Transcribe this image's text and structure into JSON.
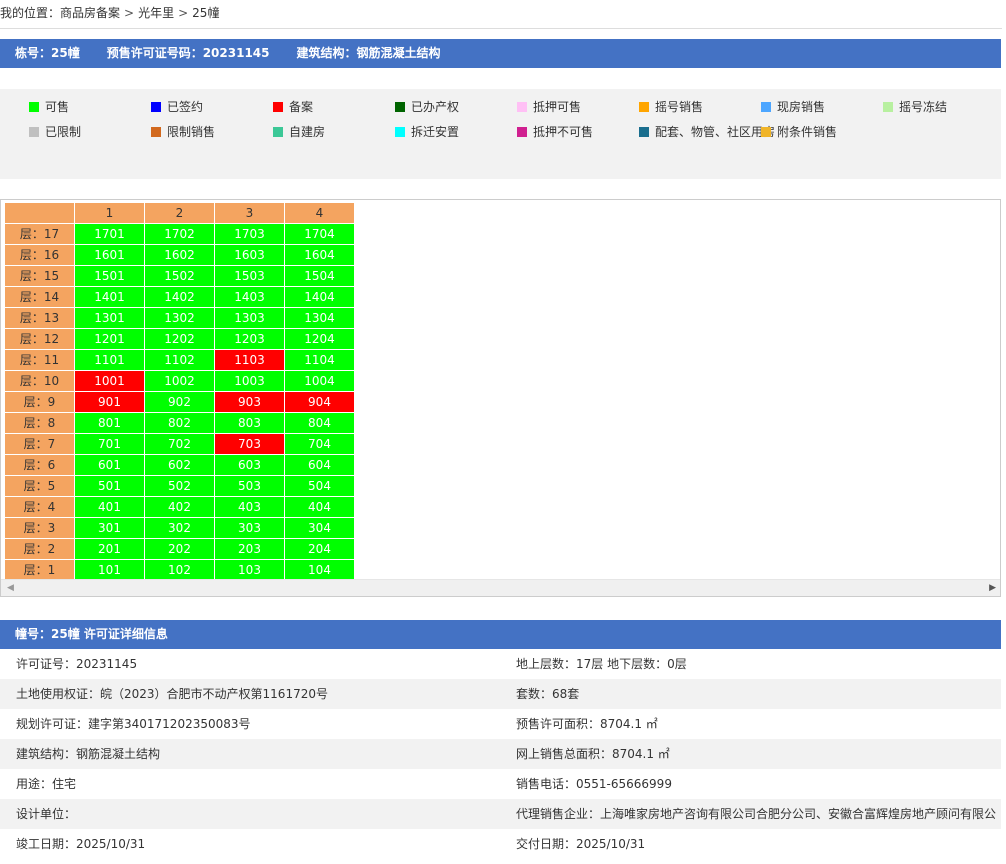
{
  "breadcrumb": {
    "prefix": "我的位置：",
    "items": [
      "商品房备案",
      "光年里",
      "25幢"
    ],
    "separator": ">"
  },
  "building_bar": {
    "building_no": "栋号：25幢",
    "presale_permit": "预售许可证号码：20231145",
    "structure": "建筑结构：钢筋混凝土结构"
  },
  "legend": [
    {
      "label": "可售",
      "color": "#00ff00"
    },
    {
      "label": "已签约",
      "color": "#0000ff"
    },
    {
      "label": "备案",
      "color": "#ff0000"
    },
    {
      "label": "已办产权",
      "color": "#006400"
    },
    {
      "label": "抵押可售",
      "color": "#ffc0f5"
    },
    {
      "label": "摇号销售",
      "color": "#ffa500"
    },
    {
      "label": "现房销售",
      "color": "#4da6ff"
    },
    {
      "label": "摇号冻结",
      "color": "#b8f0a0"
    },
    {
      "label": "已限制",
      "color": "#c0c0c0"
    },
    {
      "label": "限制销售",
      "color": "#d2691e"
    },
    {
      "label": "自建房",
      "color": "#3cc897"
    },
    {
      "label": "拆迁安置",
      "color": "#00ffff"
    },
    {
      "label": "抵押不可售",
      "color": "#d02090"
    },
    {
      "label": "配套、物管、社区用房",
      "color": "#1a6e8e"
    },
    {
      "label": "附条件销售",
      "color": "#f0b428"
    }
  ],
  "grid": {
    "columns": [
      "1",
      "2",
      "3",
      "4"
    ],
    "floor_prefix": "层：",
    "floors": [
      {
        "floor": "17",
        "units": [
          {
            "no": "1701",
            "status": "可售"
          },
          {
            "no": "1702",
            "status": "可售"
          },
          {
            "no": "1703",
            "status": "可售"
          },
          {
            "no": "1704",
            "status": "可售"
          }
        ]
      },
      {
        "floor": "16",
        "units": [
          {
            "no": "1601",
            "status": "可售"
          },
          {
            "no": "1602",
            "status": "可售"
          },
          {
            "no": "1603",
            "status": "可售"
          },
          {
            "no": "1604",
            "status": "可售"
          }
        ]
      },
      {
        "floor": "15",
        "units": [
          {
            "no": "1501",
            "status": "可售"
          },
          {
            "no": "1502",
            "status": "可售"
          },
          {
            "no": "1503",
            "status": "可售"
          },
          {
            "no": "1504",
            "status": "可售"
          }
        ]
      },
      {
        "floor": "14",
        "units": [
          {
            "no": "1401",
            "status": "可售"
          },
          {
            "no": "1402",
            "status": "可售"
          },
          {
            "no": "1403",
            "status": "可售"
          },
          {
            "no": "1404",
            "status": "可售"
          }
        ]
      },
      {
        "floor": "13",
        "units": [
          {
            "no": "1301",
            "status": "可售"
          },
          {
            "no": "1302",
            "status": "可售"
          },
          {
            "no": "1303",
            "status": "可售"
          },
          {
            "no": "1304",
            "status": "可售"
          }
        ]
      },
      {
        "floor": "12",
        "units": [
          {
            "no": "1201",
            "status": "可售"
          },
          {
            "no": "1202",
            "status": "可售"
          },
          {
            "no": "1203",
            "status": "可售"
          },
          {
            "no": "1204",
            "status": "可售"
          }
        ]
      },
      {
        "floor": "11",
        "units": [
          {
            "no": "1101",
            "status": "可售"
          },
          {
            "no": "1102",
            "status": "可售"
          },
          {
            "no": "1103",
            "status": "备案"
          },
          {
            "no": "1104",
            "status": "可售"
          }
        ]
      },
      {
        "floor": "10",
        "units": [
          {
            "no": "1001",
            "status": "备案"
          },
          {
            "no": "1002",
            "status": "可售"
          },
          {
            "no": "1003",
            "status": "可售"
          },
          {
            "no": "1004",
            "status": "可售"
          }
        ]
      },
      {
        "floor": "9",
        "units": [
          {
            "no": "901",
            "status": "备案"
          },
          {
            "no": "902",
            "status": "可售"
          },
          {
            "no": "903",
            "status": "备案"
          },
          {
            "no": "904",
            "status": "备案"
          }
        ]
      },
      {
        "floor": "8",
        "units": [
          {
            "no": "801",
            "status": "可售"
          },
          {
            "no": "802",
            "status": "可售"
          },
          {
            "no": "803",
            "status": "可售"
          },
          {
            "no": "804",
            "status": "可售"
          }
        ]
      },
      {
        "floor": "7",
        "units": [
          {
            "no": "701",
            "status": "可售"
          },
          {
            "no": "702",
            "status": "可售"
          },
          {
            "no": "703",
            "status": "备案"
          },
          {
            "no": "704",
            "status": "可售"
          }
        ]
      },
      {
        "floor": "6",
        "units": [
          {
            "no": "601",
            "status": "可售"
          },
          {
            "no": "602",
            "status": "可售"
          },
          {
            "no": "603",
            "status": "可售"
          },
          {
            "no": "604",
            "status": "可售"
          }
        ]
      },
      {
        "floor": "5",
        "units": [
          {
            "no": "501",
            "status": "可售"
          },
          {
            "no": "502",
            "status": "可售"
          },
          {
            "no": "503",
            "status": "可售"
          },
          {
            "no": "504",
            "status": "可售"
          }
        ]
      },
      {
        "floor": "4",
        "units": [
          {
            "no": "401",
            "status": "可售"
          },
          {
            "no": "402",
            "status": "可售"
          },
          {
            "no": "403",
            "status": "可售"
          },
          {
            "no": "404",
            "status": "可售"
          }
        ]
      },
      {
        "floor": "3",
        "units": [
          {
            "no": "301",
            "status": "可售"
          },
          {
            "no": "302",
            "status": "可售"
          },
          {
            "no": "303",
            "status": "可售"
          },
          {
            "no": "304",
            "status": "可售"
          }
        ]
      },
      {
        "floor": "2",
        "units": [
          {
            "no": "201",
            "status": "可售"
          },
          {
            "no": "202",
            "status": "可售"
          },
          {
            "no": "203",
            "status": "可售"
          },
          {
            "no": "204",
            "status": "可售"
          }
        ]
      },
      {
        "floor": "1",
        "units": [
          {
            "no": "101",
            "status": "可售"
          },
          {
            "no": "102",
            "status": "可售"
          },
          {
            "no": "103",
            "status": "可售"
          },
          {
            "no": "104",
            "status": "可售"
          }
        ]
      }
    ]
  },
  "permit_bar": {
    "title": "幢号：25幢 许可证详细信息"
  },
  "details": {
    "rows": [
      {
        "left": "许可证号：20231145",
        "right": "地上层数：17层  地下层数：0层"
      },
      {
        "left": "土地使用权证：皖（2023）合肥市不动产权第1161720号",
        "right": "套数：68套"
      },
      {
        "left": "规划许可证：建字第340171202350083号",
        "right": "预售许可面积：8704.1 ㎡"
      },
      {
        "left": "建筑结构：钢筋混凝土结构",
        "right": "网上销售总面积：8704.1 ㎡"
      },
      {
        "left": "用途：住宅",
        "right": "销售电话：0551-65666999"
      },
      {
        "left": "设计单位：",
        "right": "代理销售企业：上海唯家房地产咨询有限公司合肥分公司、安徽合富辉煌房地产顾问有限公"
      },
      {
        "left": "竣工日期：2025/10/31",
        "right": "交付日期：2025/10/31"
      }
    ]
  }
}
